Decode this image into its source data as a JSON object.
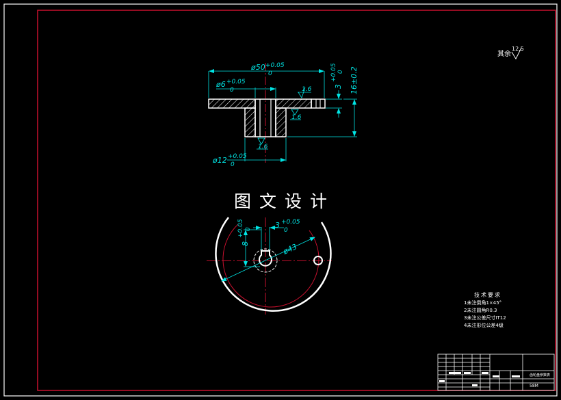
{
  "watermark": "图文设计",
  "surface_note": {
    "label": "其余",
    "roughness": "12.5"
  },
  "section_view": {
    "dims": {
      "outer_diameter": {
        "base": "ø50",
        "upper": "+0.05",
        "lower": "0"
      },
      "bore_diameter": {
        "base": "ø6",
        "upper": "+0.05",
        "lower": "0"
      },
      "hub_diameter": {
        "base": "ø12",
        "upper": "+0.05",
        "lower": "0"
      },
      "flange_thickness": {
        "base": "3",
        "upper": "+0.05",
        "lower": "0"
      },
      "total_height": "16±0.2"
    },
    "roughness": [
      "1.6",
      "1.6",
      "1.6"
    ]
  },
  "plan_view": {
    "dims": {
      "keyway_depth": {
        "base": "8",
        "upper": "+0.05",
        "lower": "0"
      },
      "keyway_width": {
        "base": "3",
        "upper": "+0.05",
        "lower": "0"
      },
      "bolt_circle": "ø43"
    }
  },
  "tech_requirements": {
    "title": "技术要求",
    "items": [
      "1未注倒角1×45°",
      "2未注圆角R0.3",
      "3未注公差尺寸IT12",
      "4未注形位公差4级"
    ]
  },
  "title_block": {
    "part_name": "齿轮盘参数表",
    "drawing_no": "58M"
  },
  "colors": {
    "background": "#000000",
    "frame": "#ffffff",
    "inner_frame": "#c8102e",
    "dimension": "#00e5e5",
    "center_line": "#c8102e",
    "outline": "#ffffff"
  }
}
